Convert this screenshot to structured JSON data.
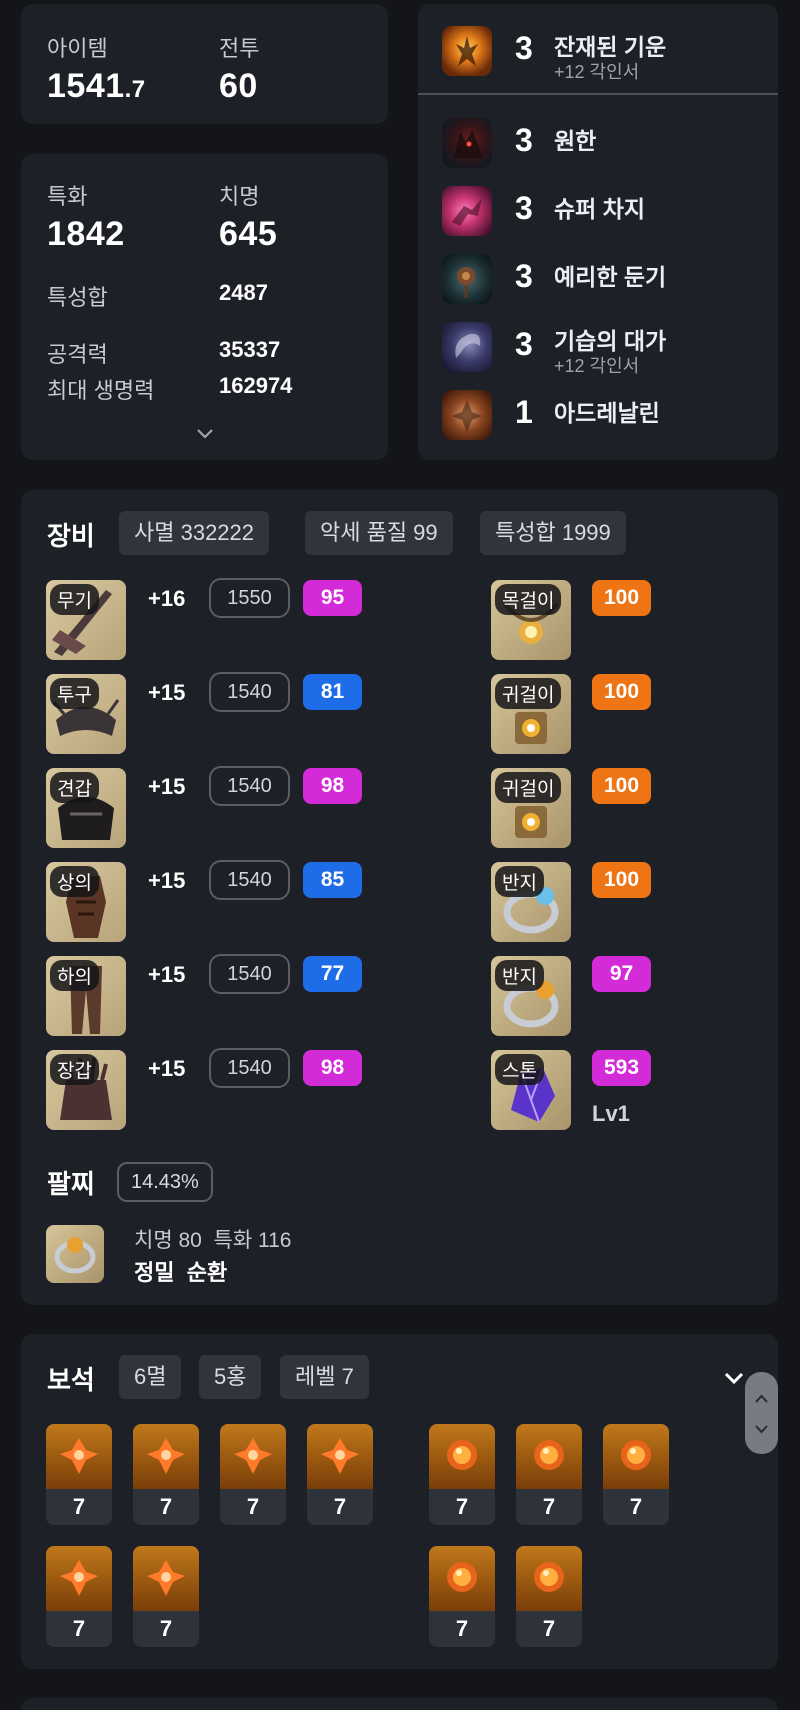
{
  "stats": {
    "item_label": "아이템",
    "item_int": "1541",
    "item_dec": ".7",
    "combat_label": "전투",
    "combat_value": "60",
    "spec_label": "특화",
    "spec_value": "1842",
    "crit_label": "치명",
    "crit_value": "645",
    "total_label": "특성합",
    "total_value": "2487",
    "atk_label": "공격력",
    "atk_value": "35337",
    "hp_label": "최대 생명력",
    "hp_value": "162974"
  },
  "engravings": [
    {
      "level": "3",
      "name": "잔재된 기운",
      "sub": "+12 각인서",
      "icon": "warrior-glow-icon"
    },
    {
      "level": "3",
      "name": "원한",
      "sub": "",
      "icon": "beast-icon"
    },
    {
      "level": "3",
      "name": "슈퍼 차지",
      "sub": "",
      "icon": "charging-fighter-icon"
    },
    {
      "level": "3",
      "name": "예리한 둔기",
      "sub": "",
      "icon": "spiked-mace-icon"
    },
    {
      "level": "3",
      "name": "기습의 대가",
      "sub": "+12 각인서",
      "icon": "ambush-swirl-icon"
    },
    {
      "level": "1",
      "name": "아드레날린",
      "sub": "",
      "icon": "adrenaline-icon"
    }
  ],
  "equipment": {
    "title": "장비",
    "chips": [
      "사멸 332222",
      "악세 품질 99",
      "특성합 1999"
    ],
    "gear": [
      {
        "tag": "무기",
        "plus": "+16",
        "level": "1550",
        "quality": "95",
        "qcolor": "#d42bd8"
      },
      {
        "tag": "투구",
        "plus": "+15",
        "level": "1540",
        "quality": "81",
        "qcolor": "#1f6ce8"
      },
      {
        "tag": "견갑",
        "plus": "+15",
        "level": "1540",
        "quality": "98",
        "qcolor": "#d42bd8"
      },
      {
        "tag": "상의",
        "plus": "+15",
        "level": "1540",
        "quality": "85",
        "qcolor": "#1f6ce8"
      },
      {
        "tag": "하의",
        "plus": "+15",
        "level": "1540",
        "quality": "77",
        "qcolor": "#1f6ce8"
      },
      {
        "tag": "장갑",
        "plus": "+15",
        "level": "1540",
        "quality": "98",
        "qcolor": "#d42bd8"
      }
    ],
    "accessories": [
      {
        "tag": "목걸이",
        "quality": "100",
        "qcolor": "#ee7414"
      },
      {
        "tag": "귀걸이",
        "quality": "100",
        "qcolor": "#ee7414"
      },
      {
        "tag": "귀걸이",
        "quality": "100",
        "qcolor": "#ee7414"
      },
      {
        "tag": "반지",
        "quality": "100",
        "qcolor": "#ee7414"
      },
      {
        "tag": "반지",
        "quality": "97",
        "qcolor": "#d42bd8"
      },
      {
        "tag": "스톤",
        "quality": "593",
        "qcolor": "#d42bd8"
      }
    ],
    "stone_level": "Lv1",
    "bracelet_title": "팔찌",
    "bracelet_chip": "14.43%",
    "bracelet_stats": "치명 80  특화 116",
    "bracelet_effects": "정밀  순환"
  },
  "gems": {
    "title": "보석",
    "chips": [
      "6멸",
      "5홍",
      "레벨 7"
    ],
    "doom": [
      "7",
      "7",
      "7",
      "7",
      "7",
      "7"
    ],
    "crimson": [
      "7",
      "7",
      "7",
      "7",
      "7"
    ]
  }
}
